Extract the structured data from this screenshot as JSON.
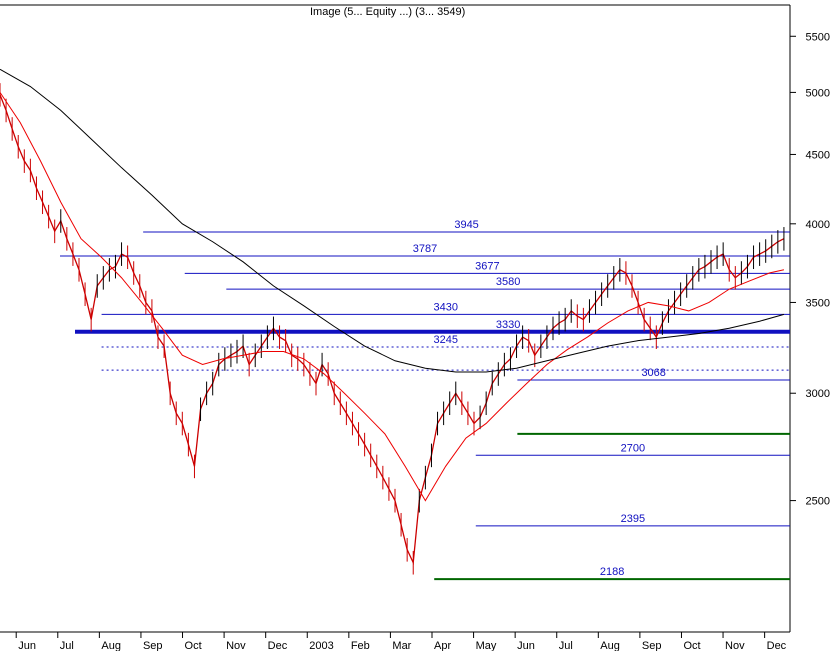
{
  "chart_data": {
    "type": "line",
    "title": "",
    "header_text": "Image (5... Equity ...) (3... 3549)",
    "xlabel": "",
    "ylabel": "",
    "y_scale": "log",
    "ylim": [
      2000,
      5800
    ],
    "y_ticks": [
      2500,
      3000,
      3500,
      4000,
      4500,
      5000,
      5500
    ],
    "x_tick_labels": [
      "Jun",
      "Jul",
      "Aug",
      "Sep",
      "Oct",
      "Nov",
      "Dec",
      "2003",
      "Feb",
      "Mar",
      "Apr",
      "May",
      "Jun",
      "Jul",
      "Aug",
      "Sep",
      "Oct",
      "Nov",
      "Dec"
    ],
    "grid": false,
    "legend": "none",
    "colors": {
      "price": "#cc0000",
      "price_up": "#000000",
      "ma_short": "#1a1acc",
      "ma_mid": "#00aa00",
      "ma_long": "#ee0000",
      "ma_200": "#000000",
      "level_blue": "#1010c0",
      "level_green": "#006600",
      "dotted": "#1010c0",
      "trend": "#00bb00"
    },
    "levels": [
      {
        "label": "3945",
        "value": 3945,
        "style": "blue",
        "from_month": "Aug",
        "to_month": "Dec"
      },
      {
        "label": "3787",
        "value": 3787,
        "style": "blue",
        "from_month": "Jun",
        "to_month": "Dec"
      },
      {
        "label": "3677",
        "value": 3677,
        "style": "blue",
        "from_month": "Sep",
        "to_month": "Dec"
      },
      {
        "label": "3580",
        "value": 3580,
        "style": "blue",
        "from_month": "Oct",
        "to_month": "Dec"
      },
      {
        "label": "3430",
        "value": 3430,
        "style": "blue",
        "from_month": "Jul",
        "to_month": "Dec"
      },
      {
        "label": "",
        "value": 3330,
        "style": "thick",
        "from_month": "Jul",
        "to_month": "Dec"
      },
      {
        "label": "3330",
        "value": 3330,
        "style": "none",
        "from_month": "Oct",
        "to_month": "Oct"
      },
      {
        "label": "3245",
        "value": 3245,
        "style": "dotted",
        "from_month": "Jul",
        "to_month": "Dec"
      },
      {
        "label": "",
        "value": 3120,
        "style": "dotted",
        "from_month": "Jul",
        "to_month": "Dec"
      },
      {
        "label": "3068",
        "value": 3068,
        "style": "blue",
        "from_month": "May",
        "to_month": "Dec"
      },
      {
        "label": "",
        "value": 2800,
        "style": "green",
        "from_month": "May",
        "to_month": "Dec"
      },
      {
        "label": "2700",
        "value": 2700,
        "style": "blue",
        "from_month": "Apr",
        "to_month": "Dec"
      },
      {
        "label": "2395",
        "value": 2395,
        "style": "blue",
        "from_month": "Apr",
        "to_month": "Dec"
      },
      {
        "label": "2188",
        "value": 2188,
        "style": "green",
        "from_month": "Mar",
        "to_month": "Dec"
      }
    ],
    "series": [
      {
        "name": "",
        "kind": "price",
        "x": [
          0,
          3,
          6,
          9,
          12,
          15,
          18,
          21,
          24,
          27,
          30,
          33,
          36,
          39,
          42,
          45,
          48,
          51,
          54,
          57,
          60,
          63,
          66,
          69,
          72,
          75,
          78,
          81,
          84,
          87,
          90,
          93,
          96,
          99,
          102,
          105,
          108,
          111,
          114,
          117,
          120,
          123,
          126,
          129,
          132,
          135,
          138,
          141,
          144,
          147,
          150,
          153,
          156,
          159,
          162,
          165,
          168,
          171,
          174,
          177,
          180,
          183,
          186,
          189,
          192,
          195,
          198,
          201,
          204,
          207,
          210,
          213,
          216,
          219,
          222,
          225,
          228,
          231,
          234,
          237,
          240,
          243,
          246,
          249,
          252,
          255,
          258,
          261,
          264,
          267,
          270,
          273,
          276,
          279,
          282,
          285,
          288,
          291,
          294,
          297,
          300,
          303,
          306,
          309,
          312,
          315,
          318,
          321,
          324,
          327,
          330,
          333,
          336,
          339,
          342,
          345,
          348,
          351,
          354,
          357,
          360,
          363,
          366,
          369,
          372,
          375,
          378,
          381,
          384,
          387
        ],
        "values": [
          4980,
          4850,
          4700,
          4560,
          4450,
          4380,
          4250,
          4150,
          4050,
          3950,
          4020,
          3900,
          3800,
          3700,
          3550,
          3400,
          3600,
          3650,
          3700,
          3720,
          3800,
          3780,
          3680,
          3600,
          3500,
          3450,
          3300,
          3250,
          3000,
          2900,
          2850,
          2750,
          2650,
          2920,
          3000,
          3050,
          3150,
          3180,
          3200,
          3220,
          3250,
          3150,
          3200,
          3250,
          3300,
          3350,
          3300,
          3280,
          3200,
          3180,
          3150,
          3100,
          3050,
          3150,
          3100,
          3000,
          2950,
          2900,
          2850,
          2800,
          2750,
          2700,
          2650,
          2600,
          2550,
          2500,
          2400,
          2300,
          2250,
          2500,
          2600,
          2700,
          2850,
          2900,
          2950,
          3000,
          2950,
          2900,
          2850,
          2880,
          2950,
          3050,
          3100,
          3150,
          3180,
          3250,
          3300,
          3280,
          3200,
          3250,
          3300,
          3350,
          3380,
          3400,
          3450,
          3420,
          3400,
          3450,
          3500,
          3550,
          3600,
          3650,
          3700,
          3680,
          3600,
          3500,
          3400,
          3350,
          3300,
          3380,
          3450,
          3500,
          3550,
          3600,
          3650,
          3700,
          3720,
          3750,
          3780,
          3800,
          3700,
          3650,
          3680,
          3720,
          3780,
          3800,
          3820,
          3850,
          3880,
          3900
        ]
      },
      {
        "name": "",
        "kind": "ma_long",
        "x": [
          0,
          10,
          20,
          30,
          40,
          50,
          60,
          70,
          80,
          90,
          100,
          110,
          120,
          130,
          140,
          150,
          160,
          170,
          180,
          190,
          200,
          210,
          220,
          230,
          240,
          250,
          260,
          270,
          280,
          290,
          300,
          310,
          320,
          330,
          340,
          350,
          360,
          370,
          380,
          387
        ],
        "values": [
          5000,
          4750,
          4450,
          4150,
          3900,
          3780,
          3650,
          3500,
          3350,
          3200,
          3150,
          3180,
          3200,
          3220,
          3220,
          3180,
          3100,
          3000,
          2900,
          2800,
          2650,
          2500,
          2650,
          2780,
          2850,
          2950,
          3050,
          3150,
          3230,
          3300,
          3380,
          3450,
          3500,
          3480,
          3450,
          3500,
          3580,
          3630,
          3680,
          3700
        ]
      },
      {
        "name": "",
        "kind": "ma_200",
        "x": [
          0,
          15,
          30,
          45,
          60,
          75,
          90,
          105,
          120,
          135,
          150,
          165,
          180,
          195,
          210,
          225,
          240,
          255,
          270,
          285,
          300,
          315,
          330,
          345,
          360,
          375,
          387
        ],
        "values": [
          5200,
          5050,
          4850,
          4620,
          4400,
          4200,
          4000,
          3880,
          3750,
          3600,
          3480,
          3360,
          3250,
          3170,
          3130,
          3110,
          3110,
          3130,
          3170,
          3210,
          3250,
          3280,
          3300,
          3320,
          3350,
          3390,
          3430
        ]
      }
    ]
  }
}
